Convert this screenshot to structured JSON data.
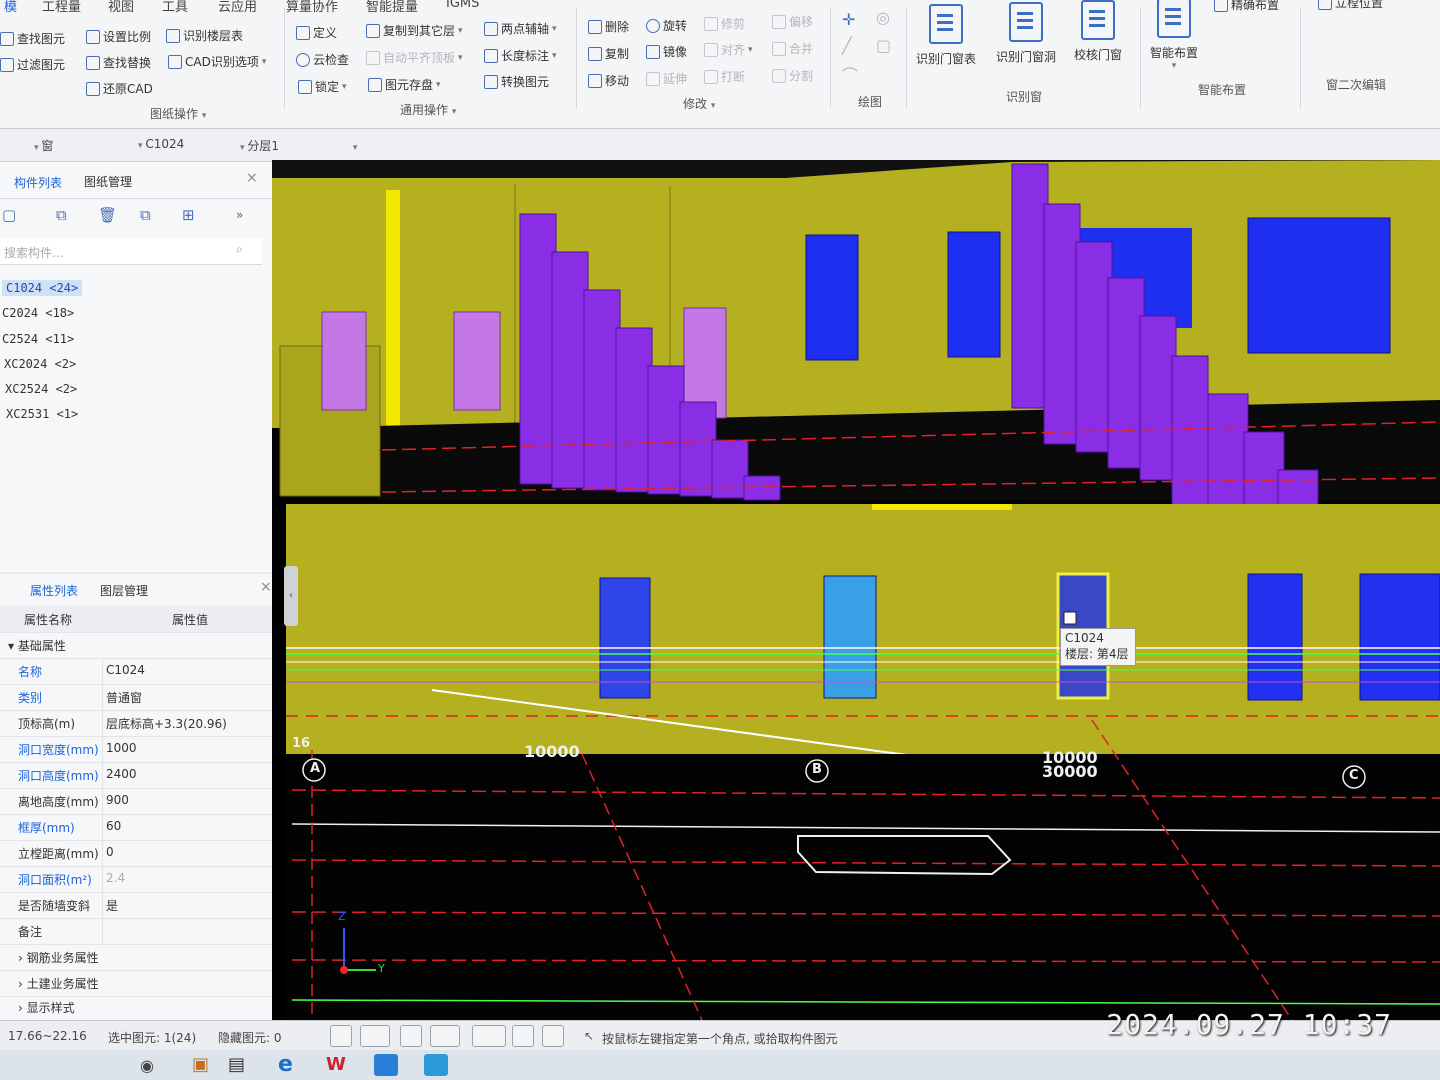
{
  "ribbon": {
    "tabs": [
      "模",
      "工程量",
      "视图",
      "工具",
      "云应用",
      "算量协作",
      "智能提量",
      "IGMS"
    ],
    "col1": [
      "查找图元",
      "过滤图元"
    ],
    "col2": [
      "设置比例",
      "查找替换",
      "还原CAD"
    ],
    "col3": [
      "识别楼层表",
      "CAD识别选项"
    ],
    "group1": "图纸操作",
    "col4": [
      "定义",
      "云检查",
      "锁定"
    ],
    "col5": [
      "复制到其它层",
      "自动平齐顶板",
      "图元存盘"
    ],
    "col6": [
      "两点辅轴",
      "长度标注",
      "转换图元"
    ],
    "group2": "通用操作",
    "col7": [
      "删除",
      "复制",
      "移动"
    ],
    "col8": [
      "旋转",
      "镜像",
      "延伸"
    ],
    "col9": [
      "修剪",
      "对齐",
      "打断"
    ],
    "col10": [
      "偏移",
      "合并",
      "分割"
    ],
    "group3": "修改",
    "group4": "绘图",
    "big1": "识别门窗表",
    "big2": "识别门窗洞",
    "big3": "校核门窗",
    "group5": "识别窗",
    "big4": "智能布置",
    "group6": "智能布置",
    "big5": "精确布置",
    "big6": "立樘位置",
    "group7": "窗二次编辑"
  },
  "selector": {
    "type": "窗",
    "component": "C1024",
    "layer": "分层1"
  },
  "component_panel": {
    "tab_active": "构件列表",
    "tab_other": "图纸管理",
    "search_placeholder": "搜索构件...",
    "items": [
      "C1024 <24>",
      "C2024 <18>",
      "C2524 <11>",
      "XC2024 <2>",
      "XC2524 <2>",
      "XC2531 <1>"
    ]
  },
  "property_panel": {
    "tab_active": "属性列表",
    "tab_other": "图层管理",
    "col_name": "属性名称",
    "col_value": "属性值",
    "section": "基础属性",
    "rows": [
      {
        "k": "名称",
        "v": "C1024"
      },
      {
        "k": "类别",
        "v": "普通窗"
      },
      {
        "k": "顶标高(m)",
        "v": "层底标高+3.3(20.96)"
      },
      {
        "k": "洞口宽度(mm)",
        "v": "1000"
      },
      {
        "k": "洞口高度(mm)",
        "v": "2400"
      },
      {
        "k": "离地高度(mm)",
        "v": "900"
      },
      {
        "k": "框厚(mm)",
        "v": "60"
      },
      {
        "k": "立樘距离(mm)",
        "v": "0"
      },
      {
        "k": "洞口面积(m²)",
        "v": "2.4"
      },
      {
        "k": "是否随墙变斜",
        "v": "是"
      },
      {
        "k": "备注",
        "v": ""
      }
    ],
    "sections_collapsed": [
      "钢筋业务属性",
      "土建业务属性",
      "显示样式"
    ]
  },
  "viewport": {
    "tooltip_name": "C1024",
    "tooltip_floor": "楼层: 第4层",
    "axis_a": "A",
    "axis_b": "B",
    "axis_c": "C",
    "axis_16": "16",
    "dim1": "10000",
    "dim2": "30000",
    "axis_z": "Z",
    "axis_y": "Y"
  },
  "status": {
    "range": "17.66~22.16",
    "selected": "选中图元: 1(24)",
    "hidden": "隐藏图元: 0",
    "hint": "按鼠标左键指定第一个角点, 或拾取构件图元"
  },
  "photo_stamp": "2024.09.27  10:37",
  "colors": {
    "wall": "#b4b020",
    "column": "#8a2ee6",
    "window": "#1f2ff0",
    "accent": "#1b64d8"
  }
}
